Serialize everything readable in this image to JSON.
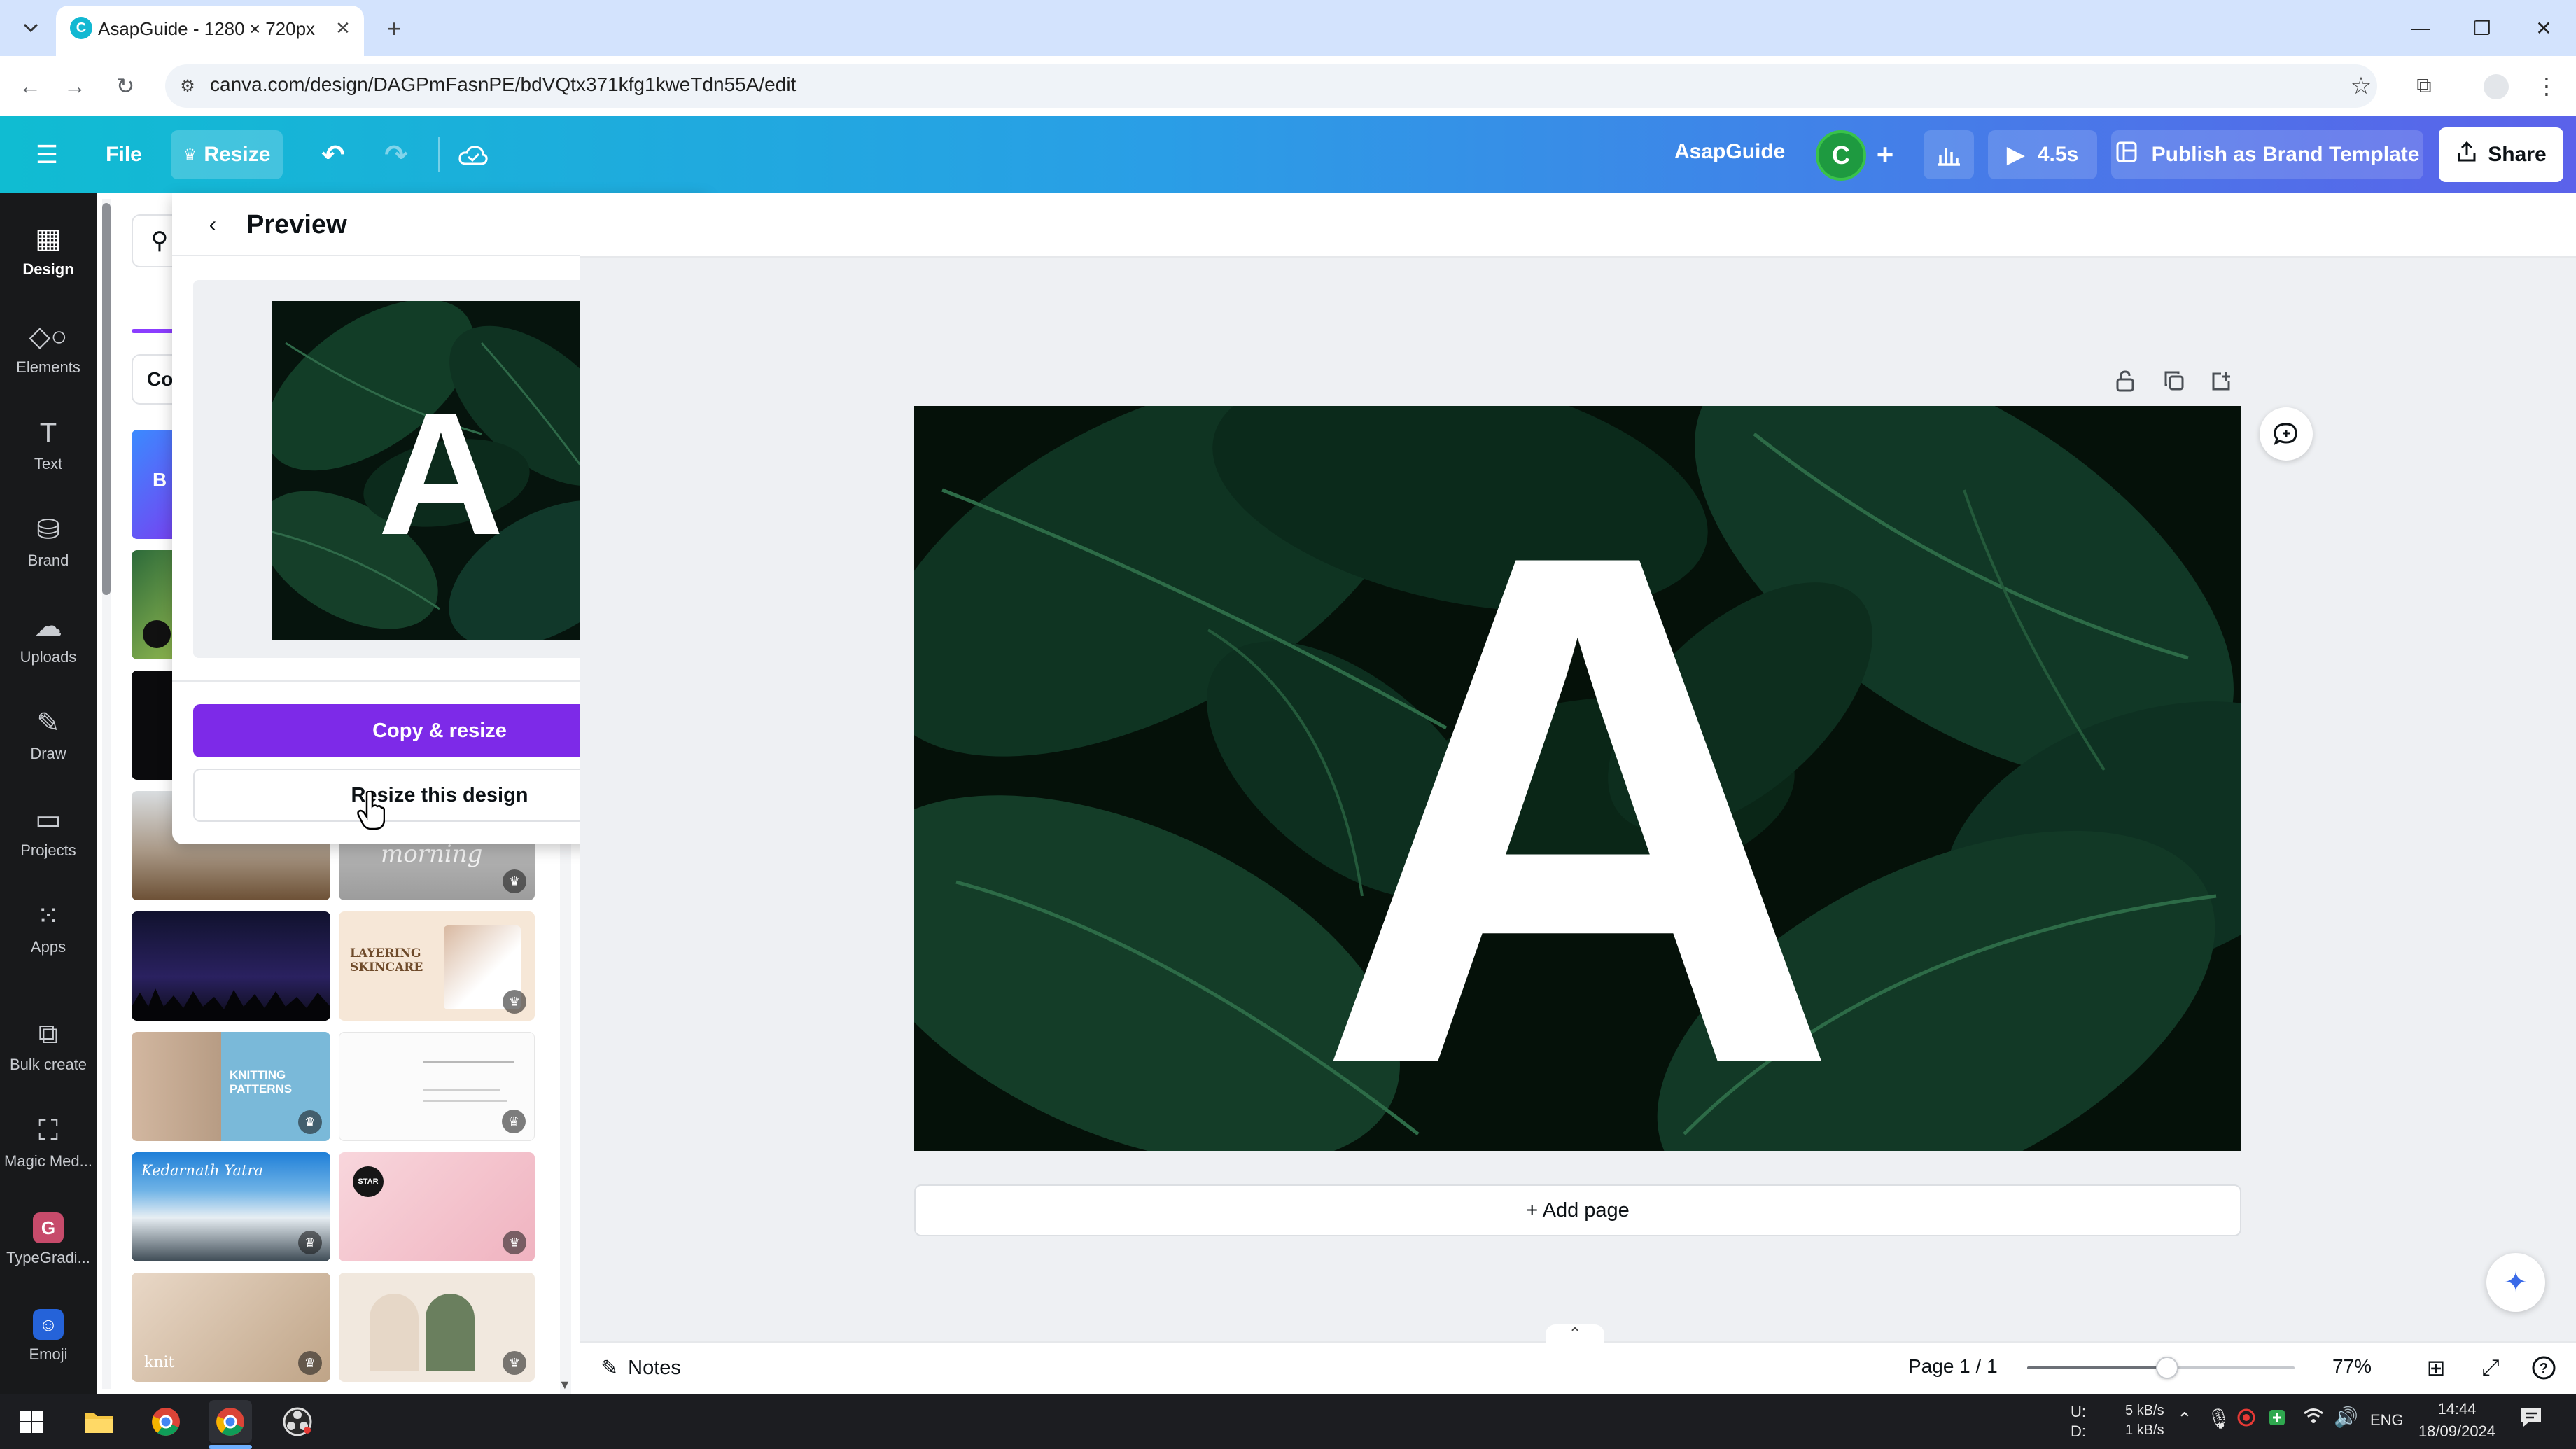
{
  "browser": {
    "tab_title": "AsapGuide - 1280 × 720px",
    "favicon_letter": "C",
    "url": "canva.com/design/DAGPmFasnPE/bdVQtx371kfg1kweTdn55A/edit"
  },
  "header": {
    "file_label": "File",
    "resize_label": "Resize",
    "team_name": "AsapGuide",
    "avatar_letter": "C",
    "play_duration": "4.5s",
    "publish_label": "Publish as Brand Template",
    "share_label": "Share"
  },
  "rail": {
    "items": [
      {
        "label": "Design",
        "icon": "design-icon"
      },
      {
        "label": "Elements",
        "icon": "elements-icon"
      },
      {
        "label": "Text",
        "icon": "text-icon"
      },
      {
        "label": "Brand",
        "icon": "brand-icon"
      },
      {
        "label": "Uploads",
        "icon": "uploads-icon"
      },
      {
        "label": "Draw",
        "icon": "draw-icon"
      },
      {
        "label": "Projects",
        "icon": "projects-icon"
      },
      {
        "label": "Apps",
        "icon": "apps-icon"
      },
      {
        "label": "Bulk create",
        "icon": "bulk-create-icon"
      },
      {
        "label": "Magic Med...",
        "icon": "magic-media-icon"
      },
      {
        "label": "TypeGradi...",
        "icon": "typegradient-icon"
      },
      {
        "label": "Emoji",
        "icon": "emoji-icon"
      }
    ]
  },
  "panel": {
    "chip_partial": "Co",
    "template_texts": {
      "morning": "morning",
      "layering": "LAYERING SKINCARE",
      "knitting": "KNITTING PATTERNS",
      "kedarnath": "Kedarnath Yatra",
      "star": "STAR",
      "knit": "knit"
    }
  },
  "preview": {
    "title": "Preview",
    "thumb_letter": "A",
    "copy_resize_label": "Copy & resize",
    "resize_design_label": "Resize this design"
  },
  "canvas": {
    "design_letter": "A",
    "add_page_label": "+ Add page"
  },
  "status": {
    "notes_label": "Notes",
    "page_indicator": "Page 1 / 1",
    "zoom_value": "77%",
    "zoom_percent": 77
  },
  "taskbar": {
    "net_u_label": "U:",
    "net_d_label": "D:",
    "net_up": "5 kB/s",
    "net_down": "1 kB/s",
    "lang": "ENG",
    "time": "14:44",
    "date": "18/09/2024"
  },
  "colors": {
    "canva_purple": "#7d2ae8",
    "header_start": "#10bcd2",
    "header_end": "#5b62ea",
    "rail_bg": "#18191b",
    "leaf_dark": "#0c2b1c"
  }
}
